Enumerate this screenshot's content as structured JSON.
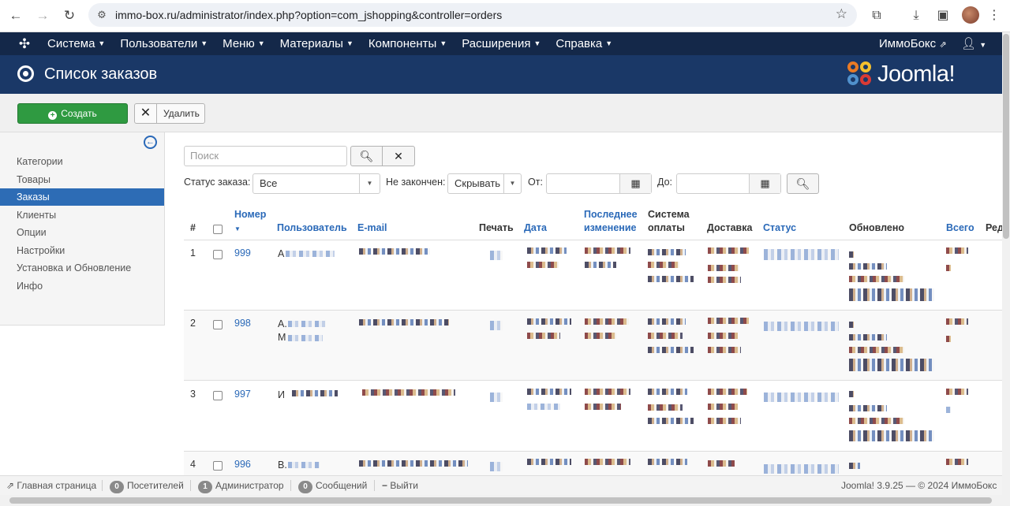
{
  "browser": {
    "url": "immo-box.ru/administrator/index.php?option=com_jshopping&controller=orders"
  },
  "navbar": {
    "menu": [
      "Система",
      "Пользователи",
      "Меню",
      "Материалы",
      "Компоненты",
      "Расширения",
      "Справка"
    ],
    "site_link": "ИммоБокс",
    "user_icon": "user-icon"
  },
  "header": {
    "title": "Список заказов",
    "brand": "Joomla!"
  },
  "toolbar": {
    "create_label": "Создать",
    "delete_label": "Удалить"
  },
  "sidebar": {
    "items": [
      {
        "label": "Категории"
      },
      {
        "label": "Товары"
      },
      {
        "label": "Заказы",
        "active": true
      },
      {
        "label": "Клиенты"
      },
      {
        "label": "Опции"
      },
      {
        "label": "Настройки"
      },
      {
        "label": "Установка и Обновление"
      },
      {
        "label": "Инфо"
      }
    ]
  },
  "filters": {
    "search_placeholder": "Поиск",
    "status_label": "Статус заказа:",
    "status_value": "Все",
    "unfinished_label": "Не закончен:",
    "unfinished_value": "Скрывать",
    "from_label": "От:",
    "to_label": "До:"
  },
  "table": {
    "columns": {
      "hash": "#",
      "number": "Номер",
      "user": "Пользователь",
      "email": "E-mail",
      "print": "Печать",
      "date": "Дата",
      "last_change_1": "Последнее",
      "last_change_2": "изменение",
      "payment_1": "Система",
      "payment_2": "оплаты",
      "delivery": "Доставка",
      "status": "Статус",
      "updated": "Обновлено",
      "total": "Всего",
      "edit": "Ред"
    },
    "rows": [
      {
        "index": "1",
        "order": "999",
        "user_initial": "А",
        "user_initial2": ""
      },
      {
        "index": "2",
        "order": "998",
        "user_initial": "А.",
        "user_initial2": "М"
      },
      {
        "index": "3",
        "order": "997",
        "user_initial": "И",
        "user_initial2": ""
      },
      {
        "index": "4",
        "order": "996",
        "user_initial": "В.",
        "user_initial2": ""
      }
    ]
  },
  "statusbar": {
    "home": "Главная страница",
    "visitors_count": "0",
    "visitors_label": "Посетителей",
    "admins_count": "1",
    "admins_label": "Администратор",
    "messages_count": "0",
    "messages_label": "Сообщений",
    "logout": "Выйти",
    "version": "Joomla! 3.9.25  —  © 2024 ИммоБокс"
  }
}
